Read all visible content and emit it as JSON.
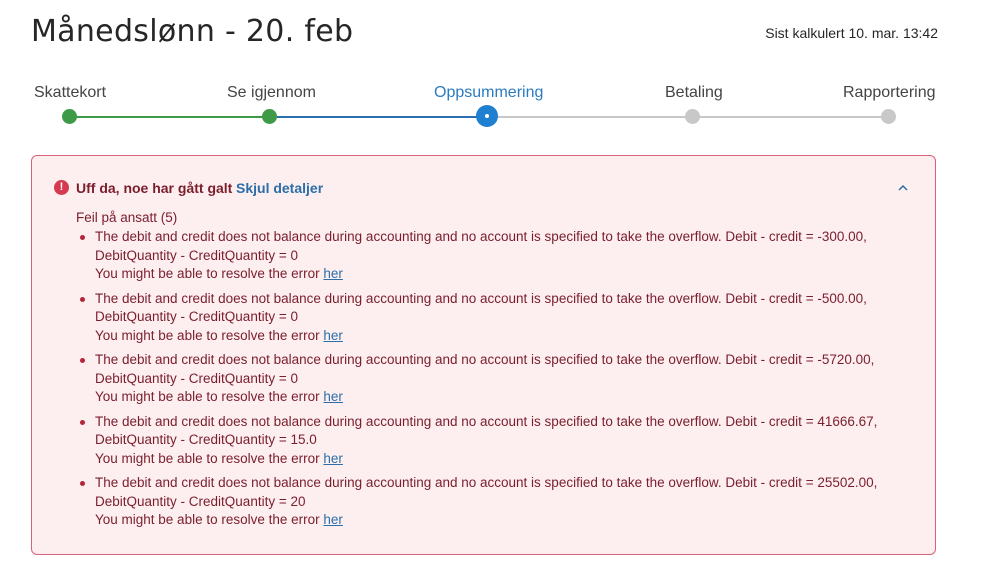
{
  "header": {
    "title": "Månedslønn - 20. feb",
    "calculated": "Sist kalkulert 10. mar. 13:42"
  },
  "stepper": {
    "steps": [
      {
        "label": "Skattekort",
        "state": "done"
      },
      {
        "label": "Se igjennom",
        "state": "done"
      },
      {
        "label": "Oppsummering",
        "state": "current"
      },
      {
        "label": "Betaling",
        "state": "pending"
      },
      {
        "label": "Rapportering",
        "state": "pending"
      }
    ],
    "colors": {
      "done": "#3f9a48",
      "current": "#1f7fd0",
      "pending": "#c8c8c8"
    }
  },
  "alert": {
    "icon": "error-circle-icon",
    "title": "Uff da, noe har gått galt",
    "toggle_label": "Skjul detaljer",
    "section_title": "Feil på ansatt (5)",
    "errors": [
      {
        "message": "The debit and credit does not balance during accounting and no account is specified to take the overflow. Debit - credit = -300.00,",
        "detail": "DebitQuantity - CreditQuantity = 0",
        "resolve_text": "You might be able to resolve the error",
        "link_text": "her"
      },
      {
        "message": "The debit and credit does not balance during accounting and no account is specified to take the overflow. Debit - credit = -500.00,",
        "detail": "DebitQuantity - CreditQuantity = 0",
        "resolve_text": "You might be able to resolve the error",
        "link_text": "her"
      },
      {
        "message": "The debit and credit does not balance during accounting and no account is specified to take the overflow. Debit - credit = -5720.00,",
        "detail": "DebitQuantity - CreditQuantity = 0",
        "resolve_text": "You might be able to resolve the error",
        "link_text": "her"
      },
      {
        "message": "The debit and credit does not balance during accounting and no account is specified to take the overflow. Debit - credit = 41666.67,",
        "detail": "DebitQuantity - CreditQuantity = 15.0",
        "resolve_text": "You might be able to resolve the error",
        "link_text": "her"
      },
      {
        "message": "The debit and credit does not balance during accounting and no account is specified to take the overflow. Debit - credit = 25502.00,",
        "detail": "DebitQuantity - CreditQuantity = 20",
        "resolve_text": "You might be able to resolve the error",
        "link_text": "her"
      }
    ]
  }
}
